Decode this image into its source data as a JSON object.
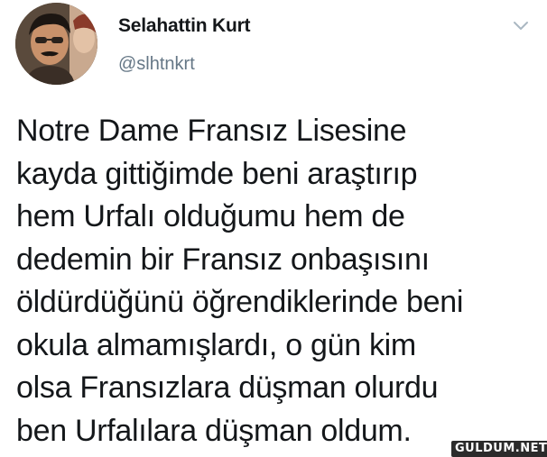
{
  "tweet": {
    "author": {
      "display_name": "Selahattin Kurt",
      "handle": "@slhtnkrt"
    },
    "text_lines": [
      "Notre Dame Fransız Lisesine",
      "kayda gittiğimde beni araştırıp",
      "hem Urfalı olduğumu hem de",
      "dedemin bir Fransız onbaşısını",
      "öldürdüğünü öğrendiklerinde beni",
      "okula almamışlardı, o gün kim",
      "olsa Fransızlara düşman olurdu",
      "ben Urfalılara düşman oldum."
    ],
    "menu_icon": "chevron-down-icon",
    "avatar_icon": "avatar-photo"
  },
  "watermark": {
    "text": "GULDUM.NET"
  },
  "colors": {
    "text": "#14171a",
    "secondary": "#657786",
    "caret": "#aab8c2",
    "background": "#ffffff"
  }
}
